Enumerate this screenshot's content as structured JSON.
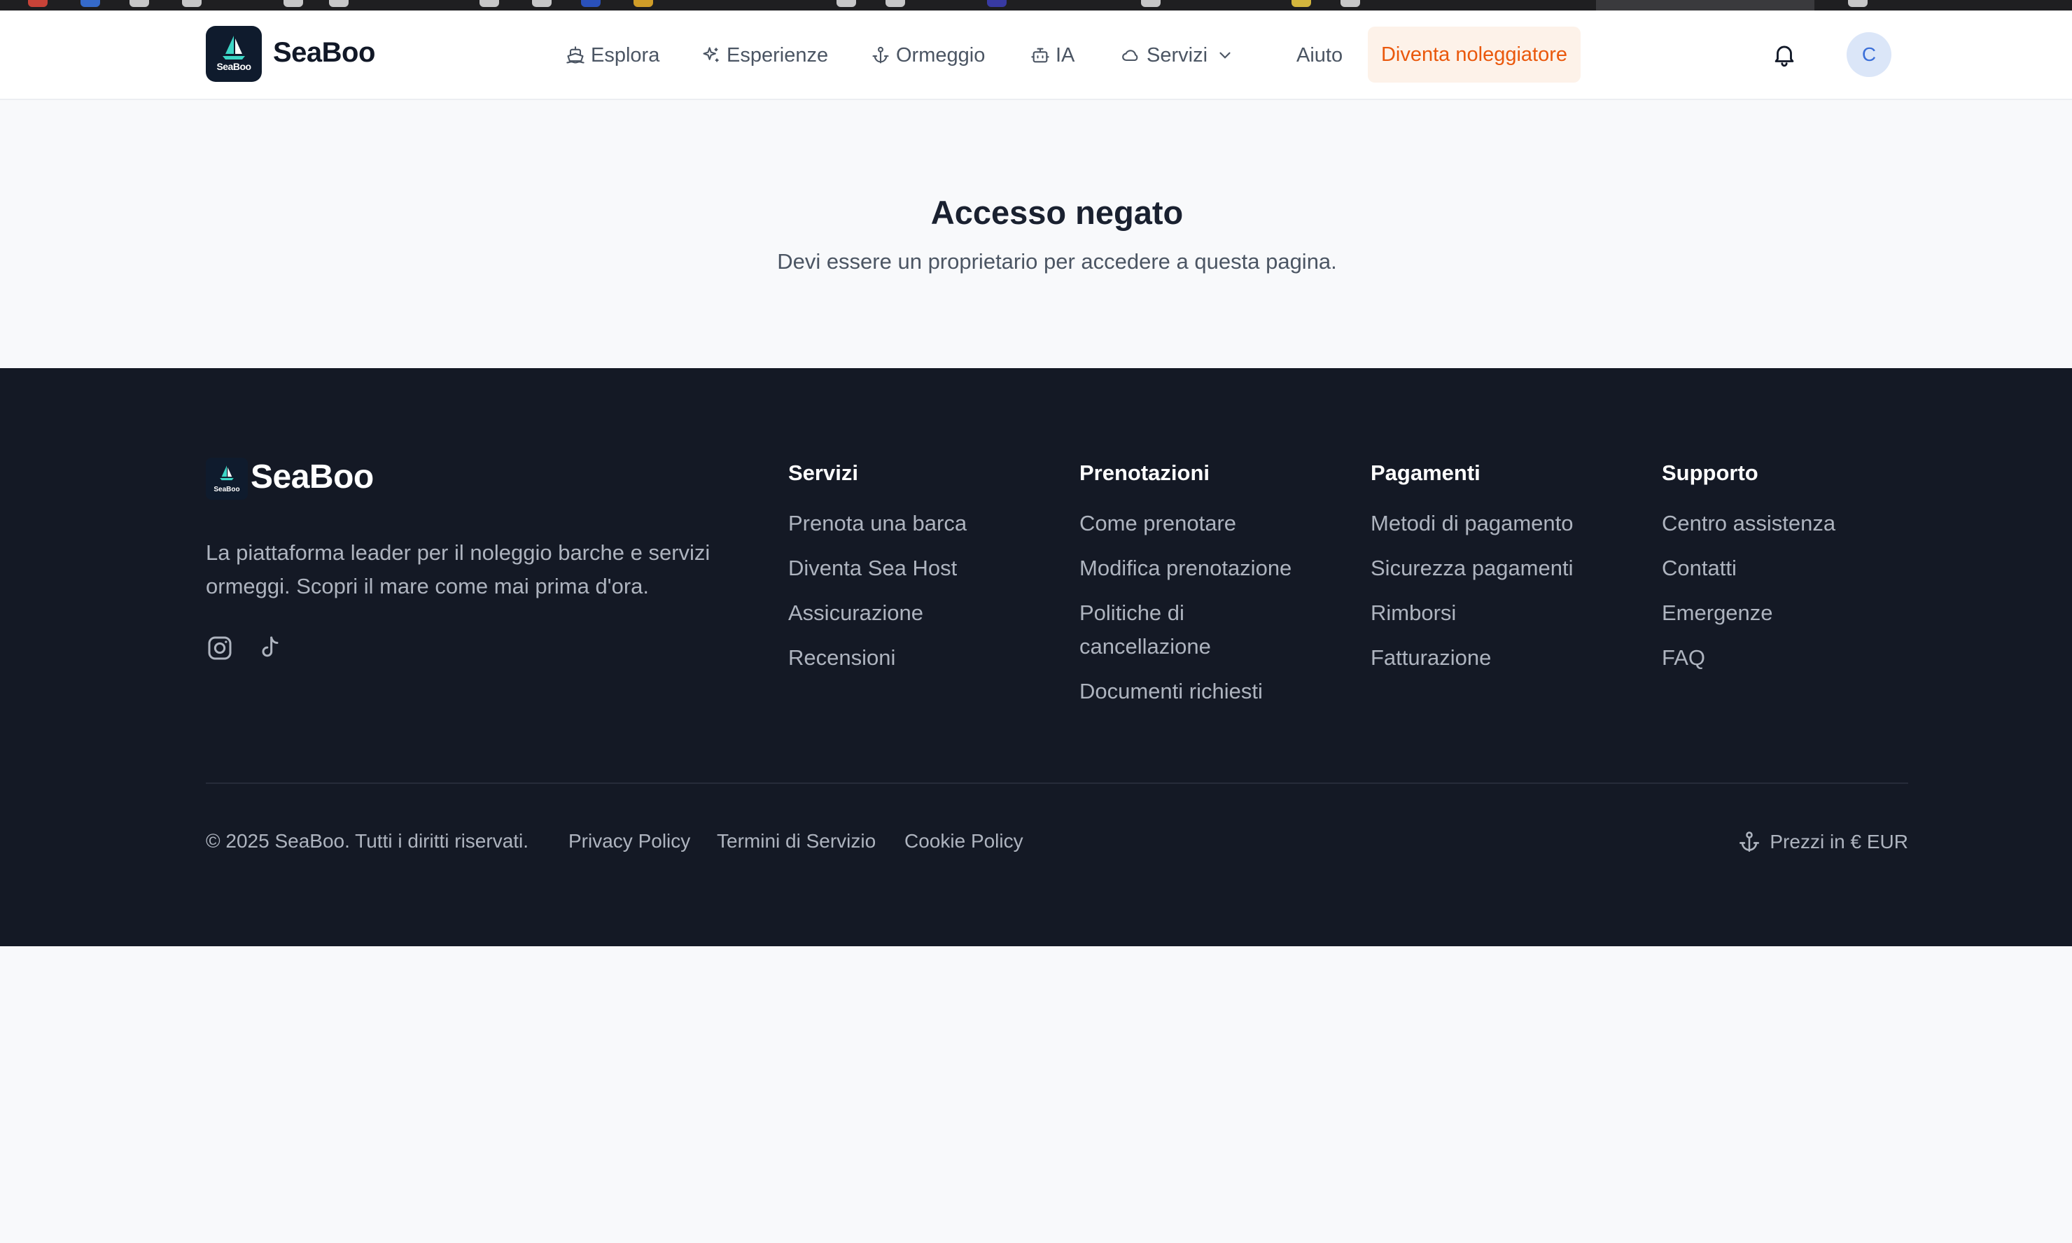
{
  "header": {
    "brand": "SeaBoo",
    "logo_text": "SeaBoo",
    "nav": [
      {
        "label": "Esplora",
        "icon": "boat-icon"
      },
      {
        "label": "Esperienze",
        "icon": "sparkles-icon"
      },
      {
        "label": "Ormeggio",
        "icon": "anchor-icon"
      },
      {
        "label": "IA",
        "icon": "bot-icon"
      },
      {
        "label": "Servizi",
        "icon": "cloud-icon"
      },
      {
        "label": "Aiuto"
      }
    ],
    "cta": "Diventa noleggiatore",
    "avatar_initial": "C"
  },
  "main": {
    "title": "Accesso negato",
    "message": "Devi essere un proprietario per accedere a questa pagina."
  },
  "footer": {
    "brand": "SeaBoo",
    "logo_text": "SeaBoo",
    "description": "La piattaforma leader per il noleggio barche e servizi ormeggi. Scopri il mare come mai prima d'ora.",
    "columns": [
      {
        "title": "Servizi",
        "links": [
          "Prenota una barca",
          "Diventa Sea Host",
          "Assicurazione",
          "Recensioni"
        ]
      },
      {
        "title": "Prenotazioni",
        "links": [
          "Come prenotare",
          "Modifica prenotazione",
          "Politiche di cancellazione",
          "Documenti richiesti"
        ]
      },
      {
        "title": "Pagamenti",
        "links": [
          "Metodi di pagamento",
          "Sicurezza pagamenti",
          "Rimborsi",
          "Fatturazione"
        ]
      },
      {
        "title": "Supporto",
        "links": [
          "Centro assistenza",
          "Contatti",
          "Emergenze",
          "FAQ"
        ]
      }
    ],
    "copyright": "© 2025 SeaBoo. Tutti i diritti riservati.",
    "legal": [
      "Privacy Policy",
      "Termini di Servizio",
      "Cookie Policy"
    ],
    "currency": "Prezzi in € EUR"
  },
  "colors": {
    "accent": "#ea580c",
    "footer_bg": "#141925",
    "brand_dark": "#0f1b2d"
  }
}
